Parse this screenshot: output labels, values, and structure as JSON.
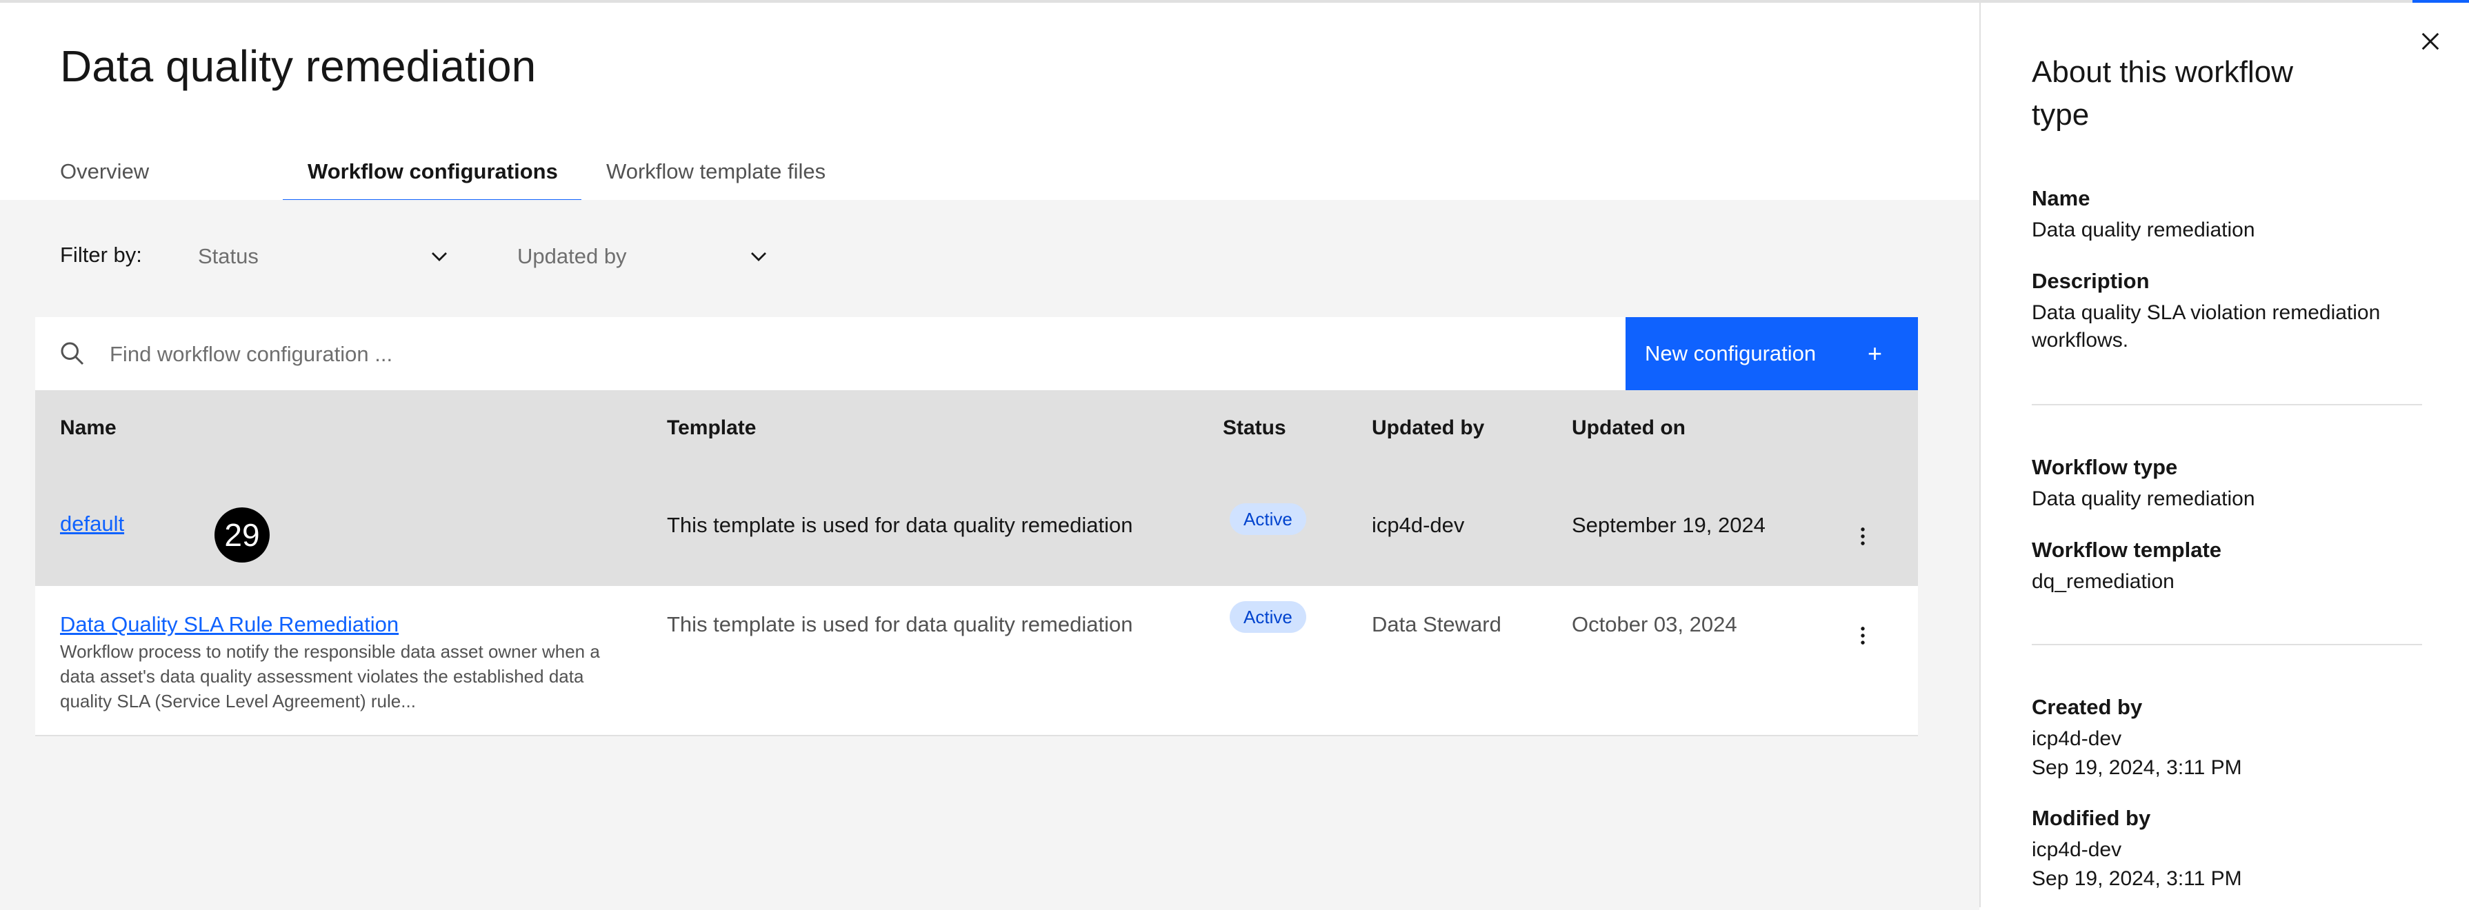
{
  "page": {
    "title": "Data quality remediation",
    "tabs": [
      "Overview",
      "Workflow configurations",
      "Workflow template files"
    ]
  },
  "filters": {
    "label": "Filter by:",
    "status_placeholder": "Status",
    "updated_by_placeholder": "Updated by"
  },
  "search": {
    "placeholder": "Find workflow configuration ..."
  },
  "new_config_label": "New configuration",
  "new_config_icon": "+",
  "table": {
    "headers": [
      "Name",
      "Template",
      "Status",
      "Updated by",
      "Updated on"
    ],
    "rows": [
      {
        "name": "default",
        "description": "",
        "template": "This template is used for data quality remediation",
        "status": "Active",
        "updated_by": "icp4d-dev",
        "updated_on": "September 19, 2024"
      },
      {
        "name": "Data Quality SLA Rule Remediation",
        "description": "Workflow process to notify the responsible data asset owner when a data asset's data quality assessment violates the established data quality SLA (Service Level Agreement) rule...",
        "template": "This template is used for data quality remediation",
        "status": "Active",
        "updated_by": "Data Steward",
        "updated_on": "October 03, 2024"
      }
    ]
  },
  "step_badge": "29",
  "panel": {
    "title": "About this workflow type",
    "name_label": "Name",
    "name_value": "Data quality remediation",
    "description_label": "Description",
    "description_value": "Data quality SLA violation remediation workflows.",
    "workflow_type_label": "Workflow type",
    "workflow_type_value": "Data quality remediation",
    "workflow_template_label": "Workflow template",
    "workflow_template_value": "dq_remediation",
    "created_by_label": "Created by",
    "created_by_user": "icp4d-dev",
    "created_by_date": "Sep 19, 2024, 3:11 PM",
    "modified_by_label": "Modified by",
    "modified_by_user": "icp4d-dev",
    "modified_by_date": "Sep 19, 2024, 3:11 PM"
  },
  "colors": {
    "accent": "#0f62fe",
    "tag_bg": "#d0e2ff",
    "tag_text": "#0043ce"
  }
}
